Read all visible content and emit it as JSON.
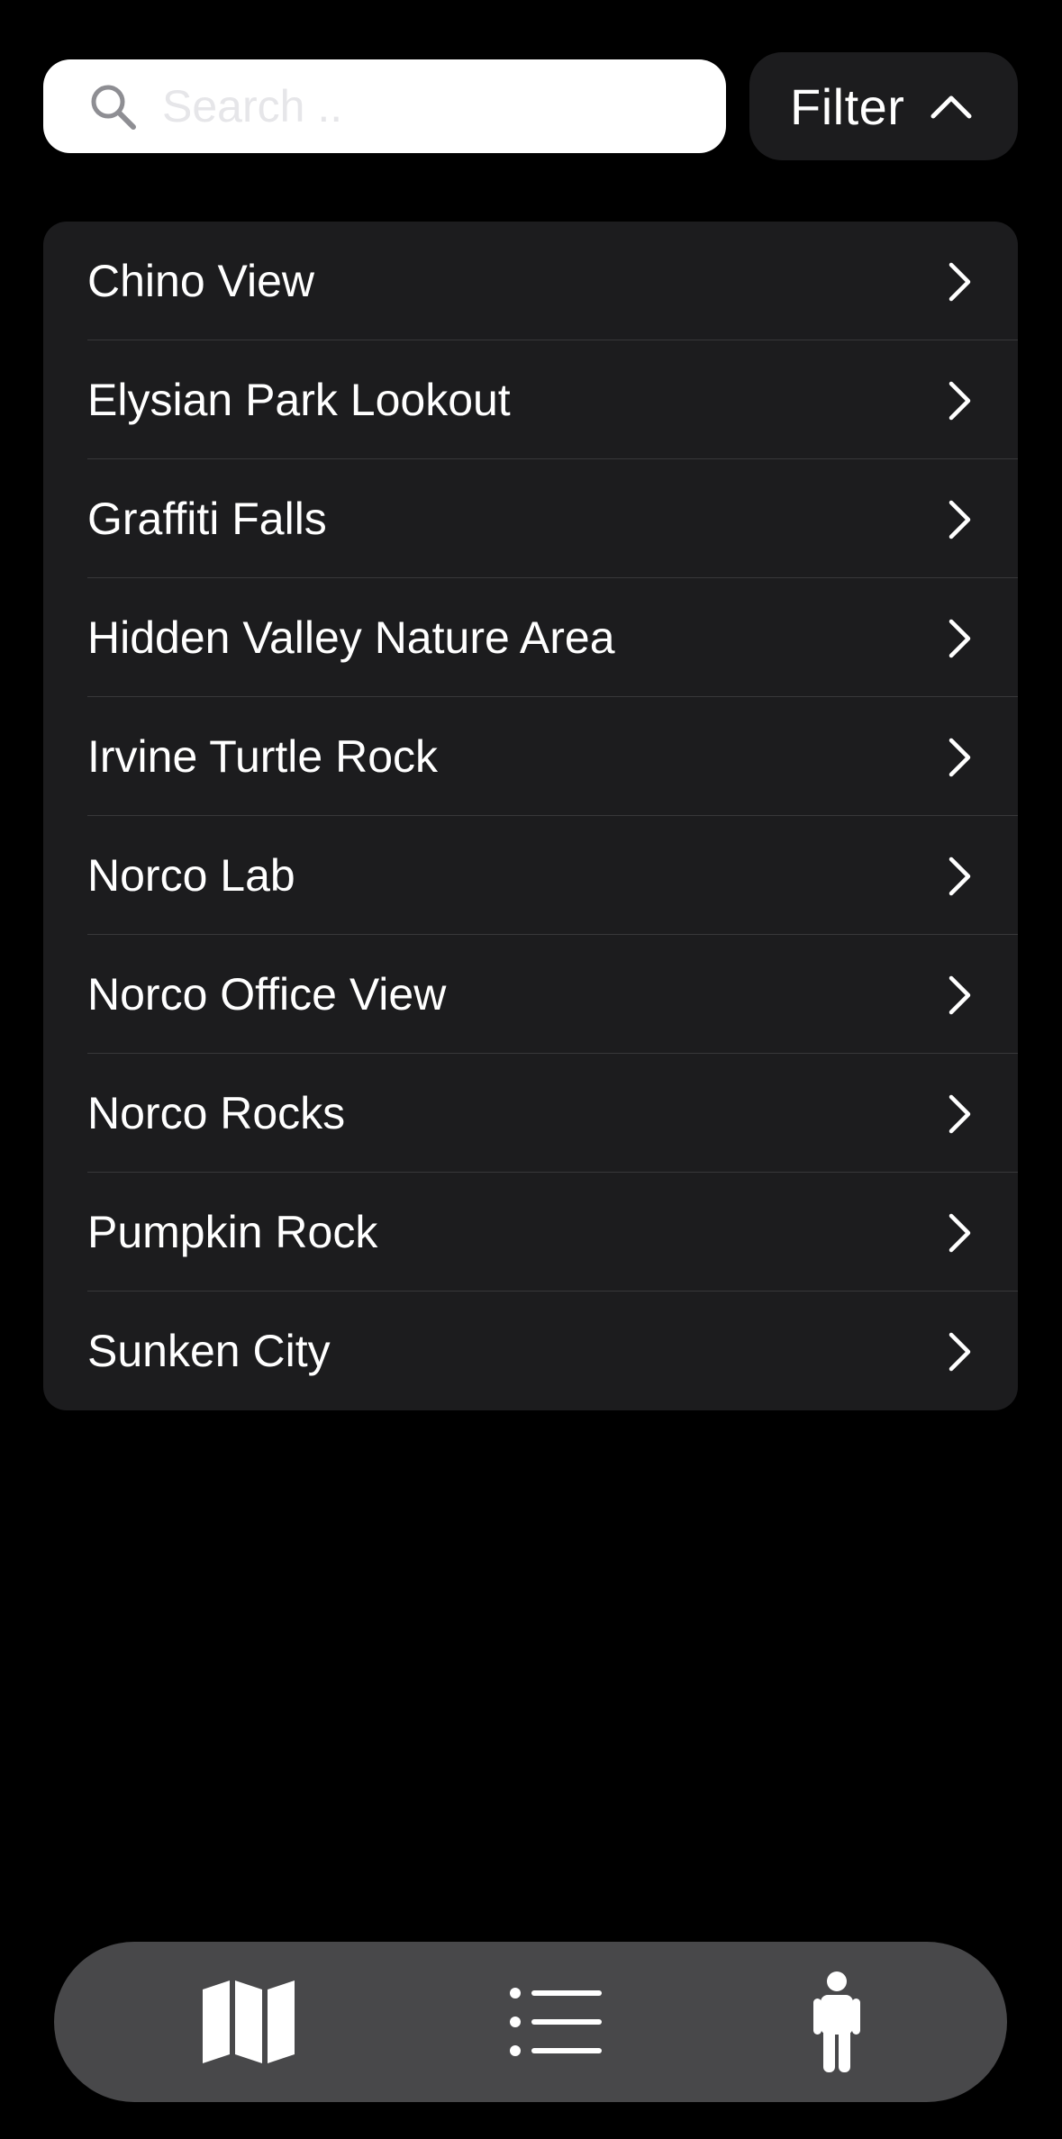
{
  "search": {
    "placeholder": "Search ..",
    "value": ""
  },
  "filter": {
    "label": "Filter",
    "icon": "chevron-up-icon"
  },
  "locations": [
    {
      "label": "Chino View"
    },
    {
      "label": "Elysian Park Lookout"
    },
    {
      "label": "Graffiti Falls"
    },
    {
      "label": "Hidden Valley Nature Area"
    },
    {
      "label": "Irvine Turtle Rock"
    },
    {
      "label": "Norco Lab"
    },
    {
      "label": "Norco Office View"
    },
    {
      "label": "Norco Rocks"
    },
    {
      "label": "Pumpkin Rock"
    },
    {
      "label": "Sunken City"
    }
  ],
  "tab_bar": {
    "tabs": [
      {
        "icon": "map-icon",
        "selected": false
      },
      {
        "icon": "list-icon",
        "selected": true
      },
      {
        "icon": "person-icon",
        "selected": false
      }
    ]
  },
  "colors": {
    "background": "#000000",
    "card": "#1c1c1e",
    "divider": "#38383a",
    "tab_bar": "#48484a",
    "text": "#ffffff",
    "search_field": "#ffffff",
    "search_icon": "#8e8e93"
  }
}
